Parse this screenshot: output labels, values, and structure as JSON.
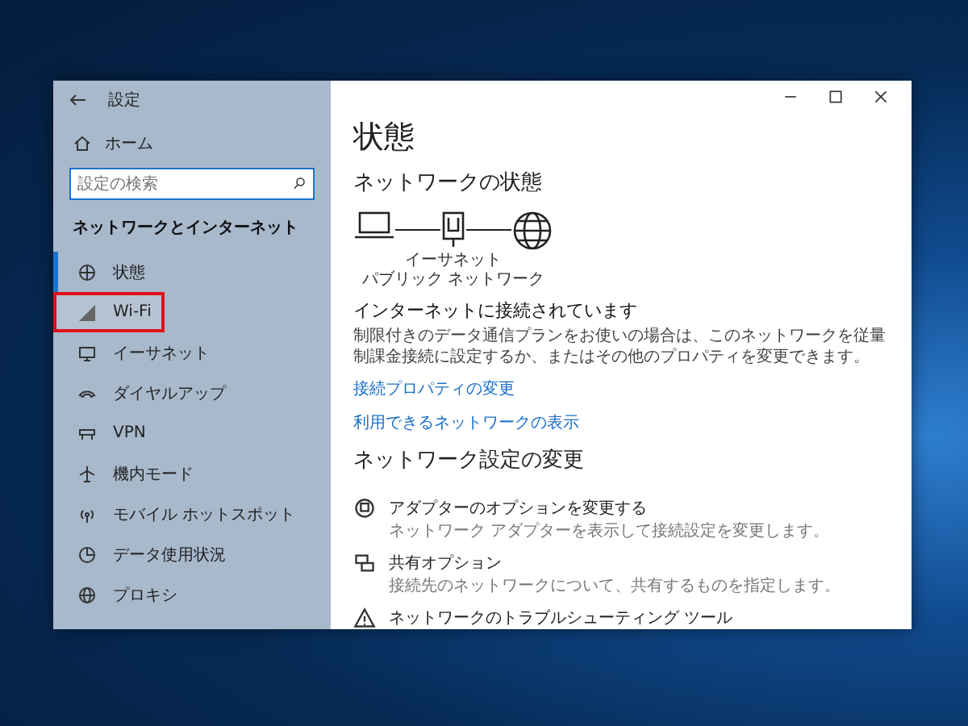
{
  "window": {
    "title": "設定"
  },
  "sidebar": {
    "home": "ホーム",
    "search": {
      "placeholder": "設定の検索"
    },
    "section": "ネットワークとインターネット",
    "items": [
      {
        "kind": "status",
        "label": "状態",
        "selected": true,
        "highlighted": false
      },
      {
        "kind": "wifi",
        "label": "Wi-Fi",
        "selected": false,
        "highlighted": true
      },
      {
        "kind": "ethernet",
        "label": "イーサネット",
        "selected": false,
        "highlighted": false
      },
      {
        "kind": "dialup",
        "label": "ダイヤルアップ",
        "selected": false,
        "highlighted": false
      },
      {
        "kind": "vpn",
        "label": "VPN",
        "selected": false,
        "highlighted": false
      },
      {
        "kind": "airplane",
        "label": "機内モード",
        "selected": false,
        "highlighted": false
      },
      {
        "kind": "hotspot",
        "label": "モバイル ホットスポット",
        "selected": false,
        "highlighted": false
      },
      {
        "kind": "data",
        "label": "データ使用状況",
        "selected": false,
        "highlighted": false
      },
      {
        "kind": "proxy",
        "label": "プロキシ",
        "selected": false,
        "highlighted": false
      }
    ]
  },
  "main": {
    "title": "状態",
    "network_heading": "ネットワークの状態",
    "diagram_labels": [
      "イーサネット",
      "パブリック ネットワーク"
    ],
    "status_heading": "インターネットに接続されています",
    "status_text": "制限付きのデータ通信プランをお使いの場合は、このネットワークを従量制課金接続に設定するか、またはその他のプロパティを変更できます。",
    "links": [
      "接続プロパティの変更",
      "利用できるネットワークの表示"
    ],
    "settings_heading": "ネットワーク設定の変更",
    "settings_items": [
      {
        "kind": "adapter",
        "title": "アダプターのオプションを変更する",
        "description": "ネットワーク アダプターを表示して接続設定を変更します。"
      },
      {
        "kind": "sharing",
        "title": "共有オプション",
        "description": "接続先のネットワークについて、共有するものを指定します。"
      },
      {
        "kind": "troubleshoot",
        "title": "ネットワークのトラブルシューティング ツール"
      }
    ]
  }
}
